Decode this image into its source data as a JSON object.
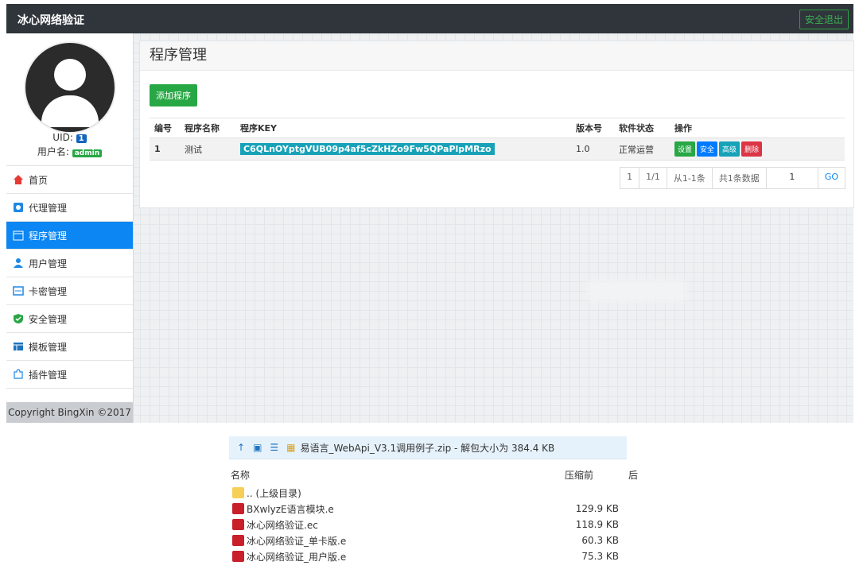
{
  "header": {
    "brand": "冰心网络验证",
    "logout": "安全退出"
  },
  "user": {
    "uid_label": "UID:",
    "uid_value": "1",
    "name_label": "用户名:",
    "name_value": "admin"
  },
  "menu": [
    {
      "label": "首页",
      "icon": "home-icon"
    },
    {
      "label": "代理管理",
      "icon": "agent-icon"
    },
    {
      "label": "程序管理",
      "icon": "calendar-icon",
      "active": true
    },
    {
      "label": "用户管理",
      "icon": "user-icon"
    },
    {
      "label": "卡密管理",
      "icon": "card-icon"
    },
    {
      "label": "安全管理",
      "icon": "shield-icon"
    },
    {
      "label": "模板管理",
      "icon": "template-icon"
    },
    {
      "label": "插件管理",
      "icon": "puzzle-icon"
    }
  ],
  "copyright": "Copyright BingXin ©2017",
  "main": {
    "title": "程序管理",
    "add_button": "添加程序",
    "columns": [
      "编号",
      "程序名称",
      "程序KEY",
      "版本号",
      "软件状态",
      "操作"
    ],
    "rows": [
      {
        "id": "1",
        "name": "测试",
        "key": "C6QLnOYptgVUB09p4af5cZkHZo9Fw5QPaPlpMRzo",
        "version": "1.0",
        "status": "正常运营"
      }
    ],
    "actions": [
      "设置",
      "安全",
      "高级",
      "删除"
    ],
    "pager": {
      "current": "1",
      "pages": "1/1",
      "range": "从1-1条",
      "total": "共1条数据",
      "input": "1",
      "go": "GO"
    }
  },
  "explorer": {
    "title": "易语言_WebApi_V3.1调用例子.zip - 解包大小为 384.4 KB",
    "col_name": "名称",
    "col_size": "压缩前",
    "col_extra": "后",
    "items": [
      {
        "name": ".. (上级目录)",
        "size": "",
        "icon": "folder-icon"
      },
      {
        "name": "BXwlyzE语言模块.e",
        "size": "129.9 KB",
        "icon": "e-file-icon"
      },
      {
        "name": "冰心网络验证.ec",
        "size": "118.9 KB",
        "icon": "e-file-icon"
      },
      {
        "name": "冰心网络验证_单卡版.e",
        "size": "60.3 KB",
        "icon": "e-file-icon"
      },
      {
        "name": "冰心网络验证_用户版.e",
        "size": "75.3 KB",
        "icon": "e-file-icon"
      }
    ]
  },
  "colors": {
    "accent": "#0b86f2",
    "success": "#28a745",
    "info": "#17a2b8",
    "danger": "#dc3545",
    "topbar": "#2f353a"
  }
}
